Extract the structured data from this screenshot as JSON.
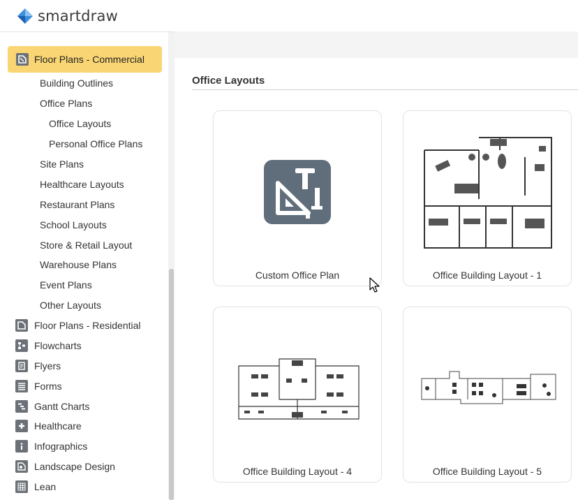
{
  "app": {
    "name": "smartdraw",
    "brand_color": "#2f7fd6"
  },
  "sidebar": {
    "active": {
      "label": "Floor Plans - Commercial",
      "icon": "floor-plan-icon",
      "highlight": "#f9d573"
    },
    "sub_items": [
      {
        "label": "Building Outlines",
        "level": 1
      },
      {
        "label": "Office Plans",
        "level": 1
      },
      {
        "label": "Office Layouts",
        "level": 2
      },
      {
        "label": "Personal Office Plans",
        "level": 2
      },
      {
        "label": "Site Plans",
        "level": 1
      },
      {
        "label": "Healthcare Layouts",
        "level": 1
      },
      {
        "label": "Restaurant Plans",
        "level": 1
      },
      {
        "label": "School Layouts",
        "level": 1
      },
      {
        "label": "Store & Retail Layout",
        "level": 1
      },
      {
        "label": "Warehouse Plans",
        "level": 1
      },
      {
        "label": "Event Plans",
        "level": 1
      },
      {
        "label": "Other Layouts",
        "level": 1
      }
    ],
    "categories": [
      {
        "label": "Floor Plans - Residential",
        "icon": "floor-plan-icon"
      },
      {
        "label": "Flowcharts",
        "icon": "flowchart-icon"
      },
      {
        "label": "Flyers",
        "icon": "flyer-icon"
      },
      {
        "label": "Forms",
        "icon": "form-icon"
      },
      {
        "label": "Gantt Charts",
        "icon": "gantt-icon"
      },
      {
        "label": "Healthcare",
        "icon": "healthcare-icon"
      },
      {
        "label": "Infographics",
        "icon": "info-icon"
      },
      {
        "label": "Landscape Design",
        "icon": "landscape-icon"
      },
      {
        "label": "Lean",
        "icon": "lean-icon"
      }
    ]
  },
  "main": {
    "section_title": "Office Layouts",
    "templates": [
      {
        "caption": "Custom Office Plan",
        "thumb": "custom-plan-icon"
      },
      {
        "caption": "Office Building Layout - 1",
        "thumb": "floor-plan-thumbnail"
      },
      {
        "caption": "Office Building Layout - 4",
        "thumb": "floor-plan-thumbnail"
      },
      {
        "caption": "Office Building Layout - 5",
        "thumb": "floor-plan-thumbnail"
      }
    ]
  }
}
